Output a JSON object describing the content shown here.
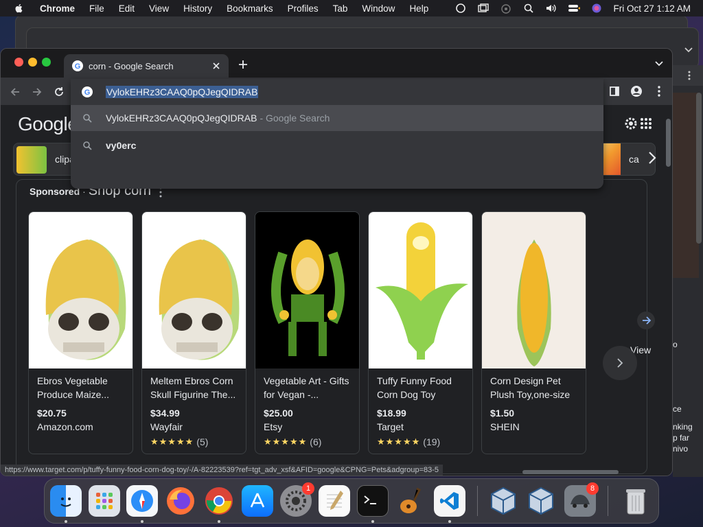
{
  "menubar": {
    "items": [
      "Chrome",
      "File",
      "Edit",
      "View",
      "History",
      "Bookmarks",
      "Profiles",
      "Tab",
      "Window",
      "Help"
    ],
    "clock": "Fri Oct 27  1:12 AM"
  },
  "tab": {
    "title": "corn - Google Search"
  },
  "omnibox": {
    "input_text": "VylokEHRz3CAAQ0pQJegQIDRAB",
    "suggestions": [
      {
        "text": "VylokEHRz3CAAQ0pQJegQIDRAB",
        "suffix": " - Google Search"
      },
      {
        "text": "vy0erc",
        "suffix": ""
      }
    ]
  },
  "page": {
    "logo": "Google",
    "chips": [
      {
        "label": "clipa"
      },
      {
        "label": "ca"
      }
    ],
    "shop": {
      "sponsored": "Sponsored",
      "dot": "·",
      "title": "Shop corn",
      "view_all": "View",
      "products": [
        {
          "name": "Ebros Vegetable Produce Maize...",
          "price": "$20.75",
          "store": "Amazon.com",
          "stars": "",
          "reviews": ""
        },
        {
          "name": "Meltem Ebros Corn Skull Figurine The...",
          "price": "$34.99",
          "store": "Wayfair",
          "stars": "★★★★★",
          "reviews": "(5)"
        },
        {
          "name": "Vegetable Art - Gifts for Vegan -...",
          "price": "$25.00",
          "store": "Etsy",
          "stars": "★★★★★",
          "reviews": "(6)"
        },
        {
          "name": "Tuffy Funny Food Corn Dog Toy",
          "price": "$18.99",
          "store": "Target",
          "stars": "★★★★★",
          "reviews": "(19)"
        },
        {
          "name": "Corn Design Pet Plush Toy,one-size",
          "price": "$1.50",
          "store": "SHEIN",
          "stars": "",
          "reviews": ""
        }
      ]
    },
    "status_url": "https://www.target.com/p/tuffy-funny-food-corn-dog-toy/-/A-82223539?ref=tgt_adv_xsf&AFID=google&CPNG=Pets&adgroup=83-5"
  },
  "right_window": {
    "texts": [
      "o",
      "ce",
      "nking",
      "p far",
      "nivo"
    ]
  },
  "dock": {
    "apps": [
      "Finder",
      "Launchpad",
      "Safari",
      "Firefox",
      "Chrome",
      "App Store",
      "System Settings",
      "TextEdit",
      "Terminal",
      "GarageBand",
      "Visual Studio Code",
      "VirtualBox",
      "VirtualBox VM",
      "Simulator",
      "Trash"
    ],
    "settings_badge": "1",
    "simulator_badge": "8"
  },
  "colors": {
    "highlight": "#3c5f93",
    "accent": "#8ab4f8",
    "stars": "#fdd663"
  }
}
